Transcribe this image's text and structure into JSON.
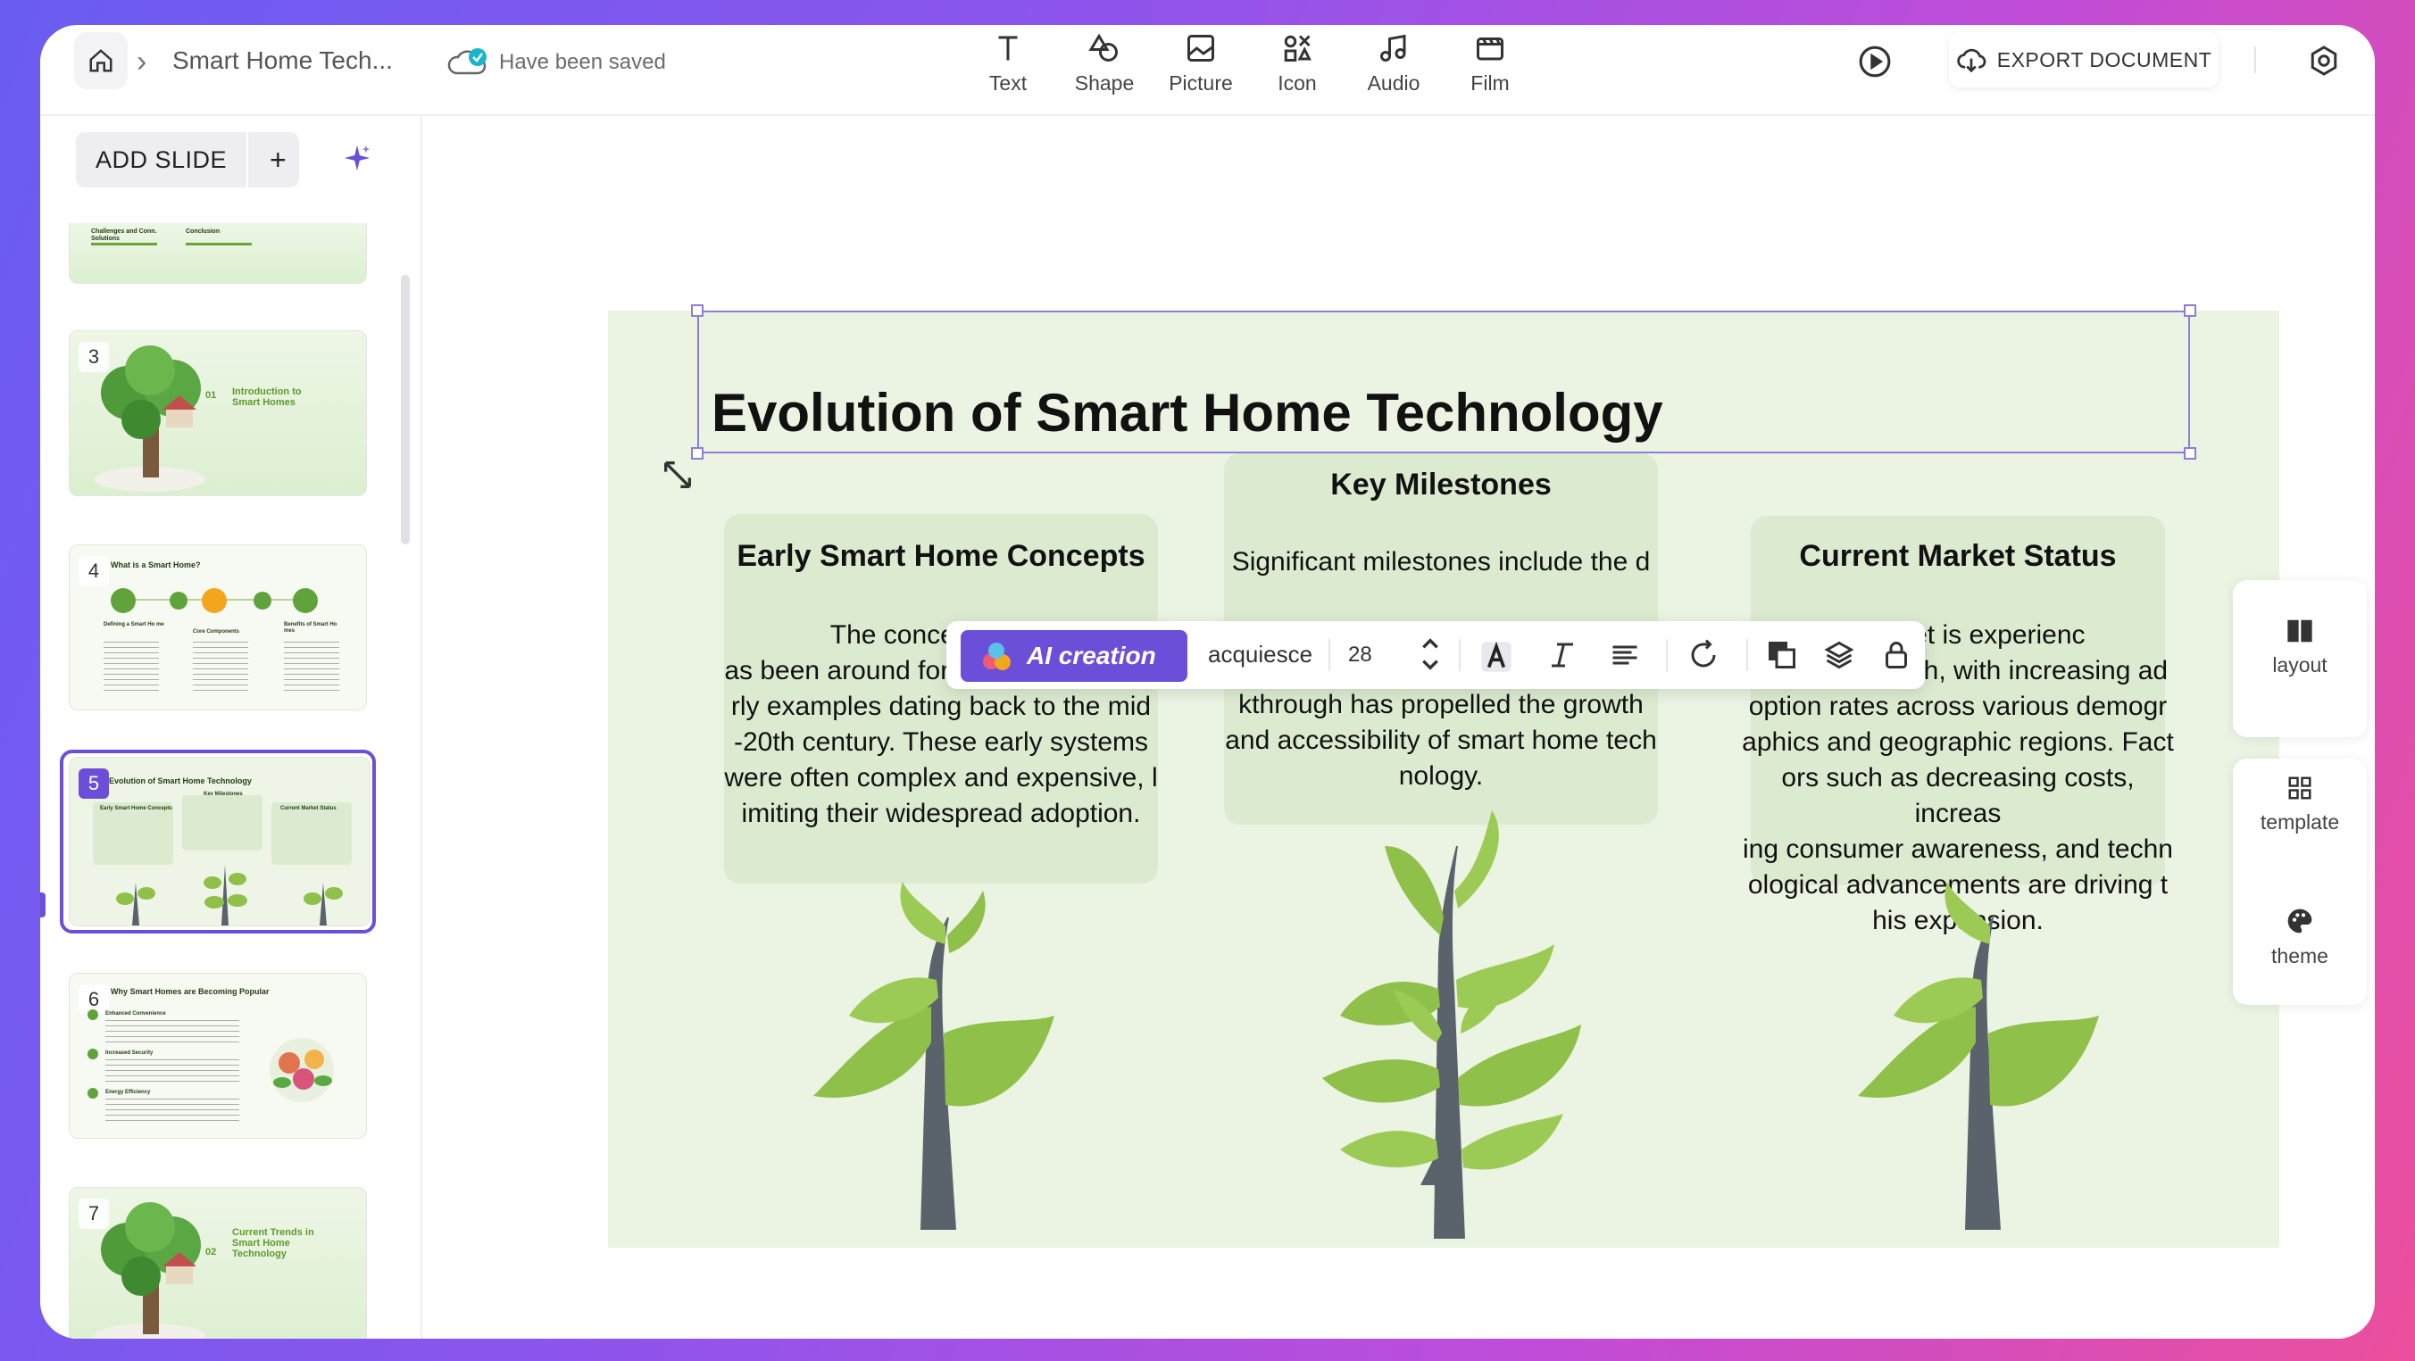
{
  "header": {
    "doc_title": "Smart Home Tech...",
    "save_status": "Have been saved",
    "tools": [
      {
        "label": "Text",
        "icon": "text-icon"
      },
      {
        "label": "Shape",
        "icon": "shape-icon"
      },
      {
        "label": "Picture",
        "icon": "picture-icon"
      },
      {
        "label": "Icon",
        "icon": "icon-library-icon"
      },
      {
        "label": "Audio",
        "icon": "audio-icon"
      },
      {
        "label": "Film",
        "icon": "film-icon"
      }
    ],
    "export_label": "EXPORT DOCUMENT"
  },
  "sidebar": {
    "add_slide_label": "ADD SLIDE",
    "add_plus": "+",
    "thumbnails": [
      {
        "num": "",
        "labels": [
          "Challenges and Conn. Solutions",
          "Conclusion"
        ]
      },
      {
        "num": "3",
        "labels": [
          "01",
          "Introduction to Smart Homes"
        ]
      },
      {
        "num": "4",
        "labels": [
          "What is a Smart Home?",
          "Defining a Smart Ho me",
          "Core Components",
          "Benefits of Smart Ho mes"
        ]
      },
      {
        "num": "5",
        "labels": [
          "Evolution of Smart Home Technology",
          "Key Milestones",
          "Early Smart Home Concepts",
          "Current Market Status"
        ]
      },
      {
        "num": "6",
        "labels": [
          "Why Smart Homes are Becoming Popular",
          "Enhanced Convenience",
          "Increased Security",
          "Energy Efficiency"
        ]
      },
      {
        "num": "7",
        "labels": [
          "02",
          "Current Trends in Smart Home Technology"
        ]
      }
    ]
  },
  "slide": {
    "title": "Evolution of Smart Home Technology",
    "cards": [
      {
        "title": "Early Smart Home Concepts",
        "body": "The concept of aut\nas been around for decades, with ea\nrly examples dating back to the mid\n-20th century. These early systems\nwere often complex and expensive, l\nimiting their widespread adoption."
      },
      {
        "title": "Key Milestones",
        "body": "Significant milestones include the d\n\nocols (e.g., Wi-Fi, Bluetooth), and th\ne Internet of Things (IoT). Each brea\nkthrough has propelled the growth\nand accessibility of smart home tech\nnology."
      },
      {
        "title": "Current Market Status",
        "body": "e market is experienc\ning rapid growth, with increasing ad\noption rates across various demogr\naphics and geographic regions. Fact\nors such as decreasing costs, increas\ning consumer awareness, and techn\nological advancements are driving t\nhis expansion."
      }
    ]
  },
  "floating_toolbar": {
    "ai_label": "AI creation",
    "font_name": "acquiesce",
    "font_size": "28"
  },
  "right_panel": {
    "layout_label": "layout",
    "template_label": "template",
    "theme_label": "theme"
  },
  "colors": {
    "accent": "#6b4fd8",
    "slide_bg": "#ebf3e2",
    "card_bg": "#dcebd0",
    "leaf_green": "#8fc04a",
    "trunk": "#5a626b"
  }
}
